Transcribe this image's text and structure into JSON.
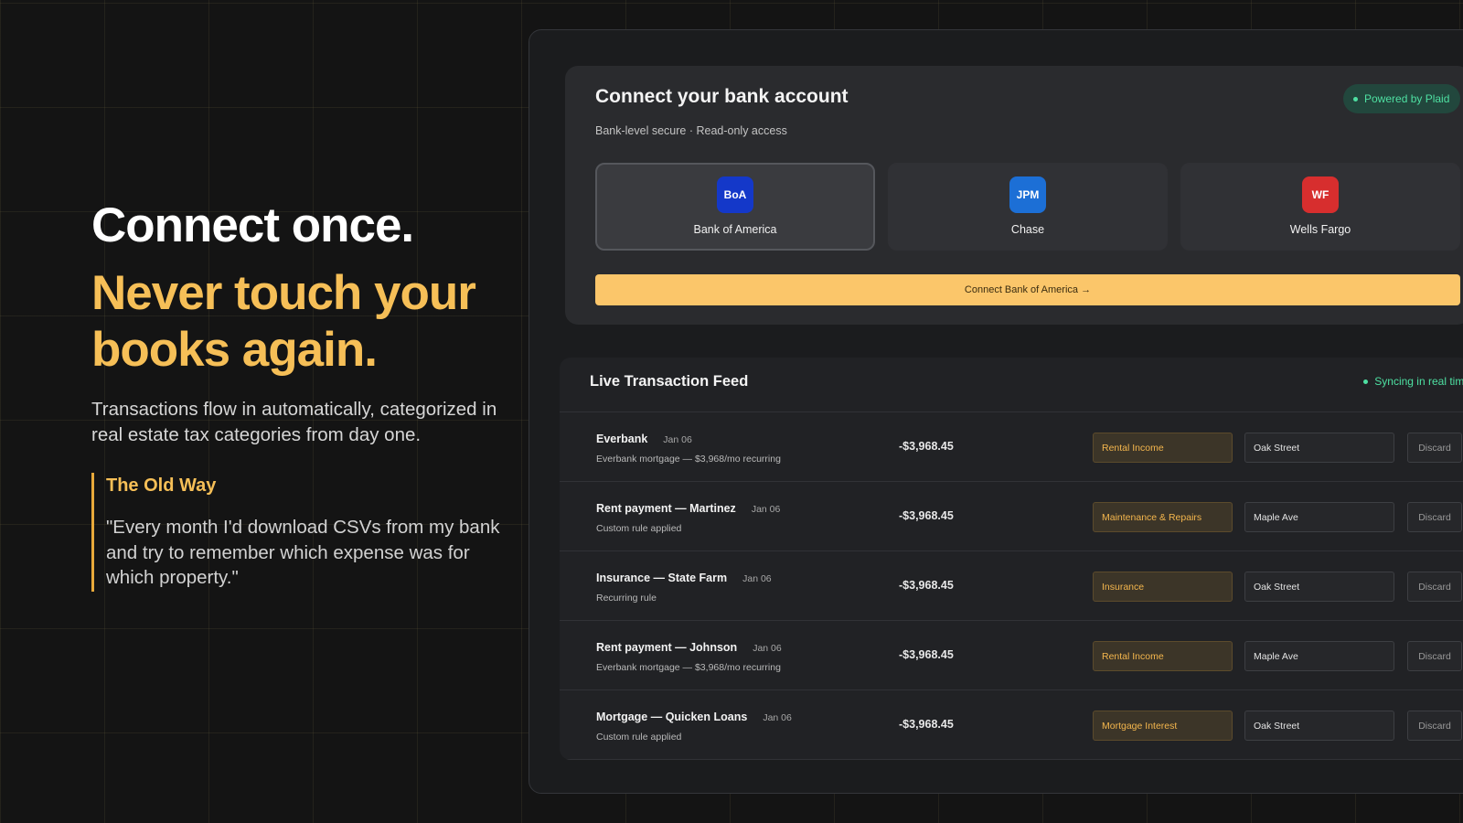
{
  "hero": {
    "headline": "Connect once.",
    "tagline": "Never touch your books again.",
    "description": "Transactions flow in automatically, categorized in real estate tax categories from day one.",
    "quote_title": "The Old Way",
    "quote_text": "\"Every month I'd download CSVs from my bank and try to remember which expense was for which property.\""
  },
  "bank_connect": {
    "title": "Connect your bank account",
    "subtitle": "Bank-level secure · Read-only access",
    "badge": "Powered by Plaid",
    "banks": [
      {
        "abbr": "BoA",
        "name": "Bank of America",
        "color": "#1438c9",
        "selected": true
      },
      {
        "abbr": "JPM",
        "name": "Chase",
        "color": "#1c6fd6",
        "selected": false
      },
      {
        "abbr": "WF",
        "name": "Wells Fargo",
        "color": "#d72e2e",
        "selected": false
      }
    ],
    "connect_button": "Connect Bank of America →"
  },
  "feed": {
    "title": "Live Transaction Feed",
    "status": "Syncing in real time",
    "discard_label": "Discard",
    "transactions": [
      {
        "name": "Everbank",
        "date": "Jan 06",
        "note": "Everbank mortgage — $3,968/mo recurring",
        "amount": "-$3,968.45",
        "category": "Rental Income",
        "property": "Oak Street"
      },
      {
        "name": "Rent payment — Martinez",
        "date": "Jan 06",
        "note": "Custom rule applied",
        "amount": "-$3,968.45",
        "category": "Maintenance & Repairs",
        "property": "Maple Ave"
      },
      {
        "name": "Insurance — State Farm",
        "date": "Jan 06",
        "note": "Recurring rule",
        "amount": "-$3,968.45",
        "category": "Insurance",
        "property": "Oak Street"
      },
      {
        "name": "Rent payment — Johnson",
        "date": "Jan 06",
        "note": "Everbank mortgage — $3,968/mo recurring",
        "amount": "-$3,968.45",
        "category": "Rental Income",
        "property": "Maple Ave"
      },
      {
        "name": "Mortgage — Quicken Loans",
        "date": "Jan 06",
        "note": "Custom rule applied",
        "amount": "-$3,968.45",
        "category": "Mortgage Interest",
        "property": "Oak Street"
      }
    ]
  },
  "colors": {
    "accent": "#f6bf57",
    "success": "#4ee0a2",
    "button": "#fbc66a"
  }
}
